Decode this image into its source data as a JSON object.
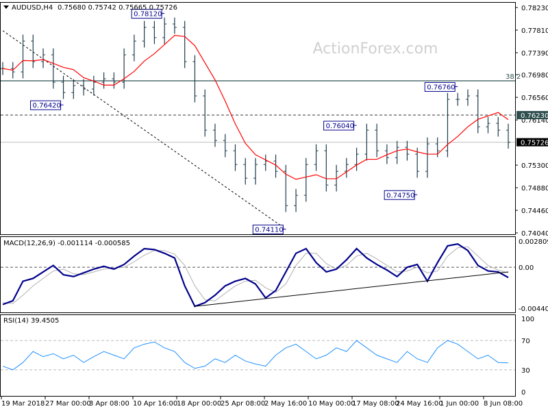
{
  "header": {
    "symbol": "AUDUSD,H4",
    "ohlc": "0.75680 0.75742 0.75665 0.75726"
  },
  "watermark": "ActionForex.com",
  "colors": {
    "bars": "#1b3a4b",
    "ma": "#ff0000",
    "macd": "#00008b",
    "signal": "#b0b0b0",
    "rsi": "#1e90ff",
    "label": "#00008b"
  },
  "chart_data": [
    {
      "type": "ohlc",
      "title": "AUDUSD,H4",
      "ylim": [
        0.7404,
        0.7823
      ],
      "yticks": [
        "0.78230",
        "0.77810",
        "0.77390",
        "0.76980",
        "0.76560",
        "0.76140",
        "0.75300",
        "0.74880",
        "0.74460",
        "0.74040"
      ],
      "xticks": [
        "19 Mar 2018",
        "27 Mar 00:00",
        "3 Apr 08:00",
        "10 Apr 16:00",
        "18 Apr 00:00",
        "25 Apr 08:00",
        "2 May 16:00",
        "10 May 00:00",
        "17 May 08:00",
        "24 May 16:00",
        "1 Jun 00:00",
        "8 Jun 08:00"
      ],
      "closes": [
        0.77096,
        0.77033,
        0.77606,
        0.77224,
        0.77351,
        0.76841,
        0.7665,
        0.76778,
        0.76714,
        0.76841,
        0.76905,
        0.76841,
        0.77351,
        0.77606,
        0.77861,
        0.7767,
        0.77924,
        0.77861,
        0.77224,
        0.76587,
        0.7595,
        0.75759,
        0.75567,
        0.75312,
        0.75058,
        0.75312,
        0.75376,
        0.75185,
        0.74548,
        0.74739,
        0.75312,
        0.75567,
        0.7493,
        0.75185,
        0.75312,
        0.75504,
        0.7595,
        0.75567,
        0.7544,
        0.75631,
        0.75504,
        0.75185,
        0.75695,
        0.75567,
        0.76523,
        0.76523,
        0.76587,
        0.76013,
        0.76077,
        0.7595,
        0.75726
      ],
      "current_price": "0.75726",
      "levels": [
        {
          "label": "38.2",
          "price": 0.76867,
          "style": "solid"
        },
        {
          "label": "0.76230",
          "price": 0.7623,
          "style": "dashed"
        }
      ],
      "annotations": [
        {
          "text": "0.78120",
          "index": 16,
          "price": 0.7812
        },
        {
          "text": "0.76420",
          "index": 6,
          "price": 0.7642
        },
        {
          "text": "0.74110",
          "index": 28,
          "price": 0.7411
        },
        {
          "text": "0.76040",
          "index": 35,
          "price": 0.7604
        },
        {
          "text": "0.74750",
          "index": 41,
          "price": 0.7475
        },
        {
          "text": "0.76760",
          "index": 45,
          "price": 0.7676
        }
      ],
      "trendline": [
        [
          0,
          0.778
        ],
        [
          28,
          0.7411
        ]
      ]
    },
    {
      "type": "line",
      "title": "MACD(12,26,9) -0.001114 -0.000585",
      "ylim": [
        -0.004403,
        0.002809
      ],
      "yticks": [
        "0.002809",
        "0.00",
        "-0.004403"
      ],
      "series": [
        {
          "values": [
            -0.004,
            -0.0036,
            -0.0015,
            -0.0012,
            -0.0005,
            0.0002,
            -0.0008,
            -0.001,
            -0.0006,
            -0.0002,
            0.0001,
            -0.0002,
            0.0003,
            0.0012,
            0.002,
            0.0019,
            0.0015,
            0.001,
            -0.002,
            -0.0042,
            -0.0038,
            -0.003,
            -0.002,
            -0.0015,
            -0.0012,
            -0.0018,
            -0.0033,
            -0.0025,
            -0.0005,
            0.0015,
            0.002,
            0.0005,
            -0.0005,
            -0.0002,
            0.0008,
            0.002,
            0.001,
            0.0003,
            -0.0003,
            -0.001,
            0.0,
            0.0003,
            -0.0015,
            0.0005,
            0.0023,
            0.0025,
            0.0018,
            0.0002,
            -0.0004,
            -0.0005,
            -0.0011
          ]
        },
        {
          "values": [
            -0.0038,
            -0.0039,
            -0.003,
            -0.002,
            -0.0012,
            -0.0004,
            -0.0002,
            -0.0007,
            -0.0008,
            -0.0005,
            -0.0002,
            -0.0001,
            0.0,
            0.0006,
            0.0013,
            0.0018,
            0.0018,
            0.0014,
            0.0002,
            -0.002,
            -0.0035,
            -0.0036,
            -0.0028,
            -0.002,
            -0.0015,
            -0.0014,
            -0.0022,
            -0.0027,
            -0.0018,
            0.0002,
            0.0015,
            0.0015,
            0.0004,
            -0.0002,
            0.0002,
            0.0012,
            0.0015,
            0.0009,
            0.0002,
            -0.0005,
            -0.0004,
            0.0,
            -0.0006,
            -0.0004,
            0.0012,
            0.0021,
            0.0022,
            0.0012,
            0.0002,
            -0.0003,
            -0.0006
          ]
        }
      ],
      "trendline": [
        [
          19,
          -0.0042
        ],
        [
          50,
          -0.0005
        ]
      ]
    },
    {
      "type": "line",
      "title": "RSI(14) 39.4505",
      "ylim": [
        0,
        100
      ],
      "yticks": [
        "100",
        "70",
        "30",
        "0"
      ],
      "levels": [
        70,
        30
      ],
      "values": [
        35,
        30,
        40,
        55,
        48,
        52,
        45,
        50,
        40,
        48,
        55,
        50,
        45,
        60,
        65,
        68,
        60,
        55,
        40,
        32,
        35,
        45,
        40,
        50,
        42,
        38,
        35,
        50,
        60,
        65,
        55,
        45,
        50,
        60,
        55,
        70,
        60,
        50,
        45,
        40,
        55,
        45,
        40,
        60,
        70,
        65,
        55,
        45,
        50,
        40,
        39.45
      ]
    }
  ]
}
